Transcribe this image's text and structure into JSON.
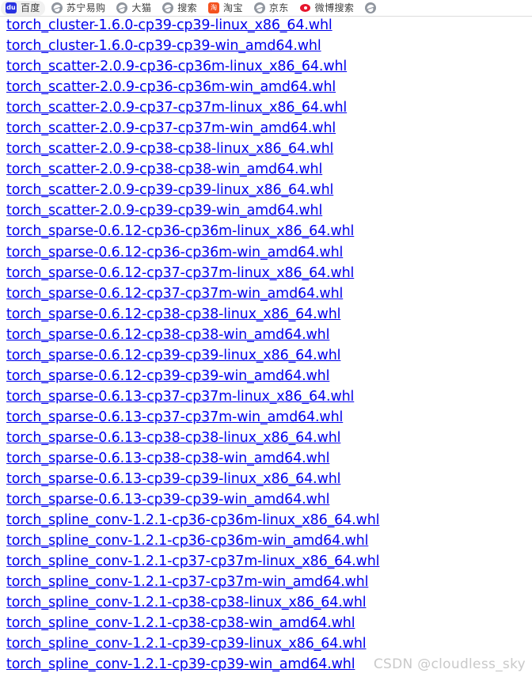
{
  "bookmarks_bar": {
    "items": [
      {
        "label": "百度",
        "icon": "baidu-icon",
        "icon_text": "du",
        "icon_kind": "baidu",
        "hovered": true
      },
      {
        "label": "苏宁易购",
        "icon": "globe-icon",
        "icon_text": "",
        "icon_kind": "globe",
        "hovered": false
      },
      {
        "label": "大猫",
        "icon": "globe-icon",
        "icon_text": "",
        "icon_kind": "globe",
        "hovered": false
      },
      {
        "label": "搜索",
        "icon": "globe-icon",
        "icon_text": "",
        "icon_kind": "globe",
        "hovered": false
      },
      {
        "label": "淘宝",
        "icon": "taobao-icon",
        "icon_text": "淘",
        "icon_kind": "taobao",
        "hovered": false
      },
      {
        "label": "京东",
        "icon": "globe-icon",
        "icon_text": "",
        "icon_kind": "globe",
        "hovered": false
      },
      {
        "label": "微博搜索",
        "icon": "weibo-icon",
        "icon_text": "",
        "icon_kind": "weibo",
        "hovered": false
      },
      {
        "label": "",
        "icon": "globe-icon",
        "icon_text": "",
        "icon_kind": "globe",
        "hovered": false
      }
    ]
  },
  "listing": {
    "links": [
      "torch_cluster-1.6.0-cp39-cp39-linux_x86_64.whl",
      "torch_cluster-1.6.0-cp39-cp39-win_amd64.whl",
      "torch_scatter-2.0.9-cp36-cp36m-linux_x86_64.whl",
      "torch_scatter-2.0.9-cp36-cp36m-win_amd64.whl",
      "torch_scatter-2.0.9-cp37-cp37m-linux_x86_64.whl",
      "torch_scatter-2.0.9-cp37-cp37m-win_amd64.whl",
      "torch_scatter-2.0.9-cp38-cp38-linux_x86_64.whl",
      "torch_scatter-2.0.9-cp38-cp38-win_amd64.whl",
      "torch_scatter-2.0.9-cp39-cp39-linux_x86_64.whl",
      "torch_scatter-2.0.9-cp39-cp39-win_amd64.whl",
      "torch_sparse-0.6.12-cp36-cp36m-linux_x86_64.whl",
      "torch_sparse-0.6.12-cp36-cp36m-win_amd64.whl",
      "torch_sparse-0.6.12-cp37-cp37m-linux_x86_64.whl",
      "torch_sparse-0.6.12-cp37-cp37m-win_amd64.whl",
      "torch_sparse-0.6.12-cp38-cp38-linux_x86_64.whl",
      "torch_sparse-0.6.12-cp38-cp38-win_amd64.whl",
      "torch_sparse-0.6.12-cp39-cp39-linux_x86_64.whl",
      "torch_sparse-0.6.12-cp39-cp39-win_amd64.whl",
      "torch_sparse-0.6.13-cp37-cp37m-linux_x86_64.whl",
      "torch_sparse-0.6.13-cp37-cp37m-win_amd64.whl",
      "torch_sparse-0.6.13-cp38-cp38-linux_x86_64.whl",
      "torch_sparse-0.6.13-cp38-cp38-win_amd64.whl",
      "torch_sparse-0.6.13-cp39-cp39-linux_x86_64.whl",
      "torch_sparse-0.6.13-cp39-cp39-win_amd64.whl",
      "torch_spline_conv-1.2.1-cp36-cp36m-linux_x86_64.whl",
      "torch_spline_conv-1.2.1-cp36-cp36m-win_amd64.whl",
      "torch_spline_conv-1.2.1-cp37-cp37m-linux_x86_64.whl",
      "torch_spline_conv-1.2.1-cp37-cp37m-win_amd64.whl",
      "torch_spline_conv-1.2.1-cp38-cp38-linux_x86_64.whl",
      "torch_spline_conv-1.2.1-cp38-cp38-win_amd64.whl",
      "torch_spline_conv-1.2.1-cp39-cp39-linux_x86_64.whl",
      "torch_spline_conv-1.2.1-cp39-cp39-win_amd64.whl"
    ]
  },
  "watermark": {
    "text": "CSDN @cloudless_sky"
  },
  "colors": {
    "link": "#0000ee",
    "bookmark_label": "#3c3c3c",
    "watermark": "#c9c9c9",
    "baidu": "#2932e1",
    "taobao": "#f4521f",
    "weibo": "#e6162d",
    "globe": "#8f959e"
  }
}
